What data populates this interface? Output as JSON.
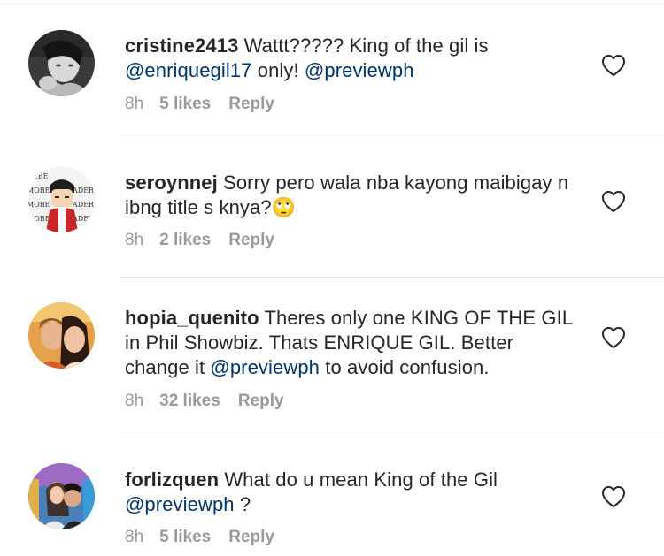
{
  "comments": [
    {
      "username": "cristine2413",
      "parts": [
        {
          "text": " Wattt????? King of the gil is ",
          "type": "text"
        },
        {
          "text": "@enriquegil17",
          "type": "mention"
        },
        {
          "text": " only! ",
          "type": "text"
        },
        {
          "text": "@previewph",
          "type": "mention"
        }
      ],
      "time": "8h",
      "likes": "5 likes",
      "reply": "Reply"
    },
    {
      "username": "seroynnej",
      "parts": [
        {
          "text": " Sorry pero wala nba kayong maibigay n ibng title s knya?",
          "type": "text"
        },
        {
          "text": "🙄",
          "type": "emoji"
        }
      ],
      "time": "8h",
      "likes": "2 likes",
      "reply": "Reply"
    },
    {
      "username": "hopia_quenito",
      "parts": [
        {
          "text": " Theres only one KING OF THE GIL in Phil Showbiz. Thats ENRIQUE GIL. Better change it ",
          "type": "text"
        },
        {
          "text": "@previewph",
          "type": "mention"
        },
        {
          "text": " to avoid confusion.",
          "type": "text"
        }
      ],
      "time": "8h",
      "likes": "32 likes",
      "reply": "Reply"
    },
    {
      "username": "forlizquen",
      "parts": [
        {
          "text": " What do u mean King of the Gil ",
          "type": "text"
        },
        {
          "text": "@previewph",
          "type": "mention"
        },
        {
          "text": " ?",
          "type": "text"
        }
      ],
      "time": "8h",
      "likes": "5 likes",
      "reply": "Reply"
    }
  ],
  "avatar_sign_text": [
    "MOBE",
    "MOBE",
    "ADERA",
    "MOBE",
    "ADERA",
    "MOBE",
    "ADERA"
  ],
  "colors": {
    "username": "#262626",
    "mention": "#003569",
    "meta": "#999999",
    "divider": "#e6e6e6"
  },
  "icons": {
    "like": "heart-outline-icon"
  }
}
